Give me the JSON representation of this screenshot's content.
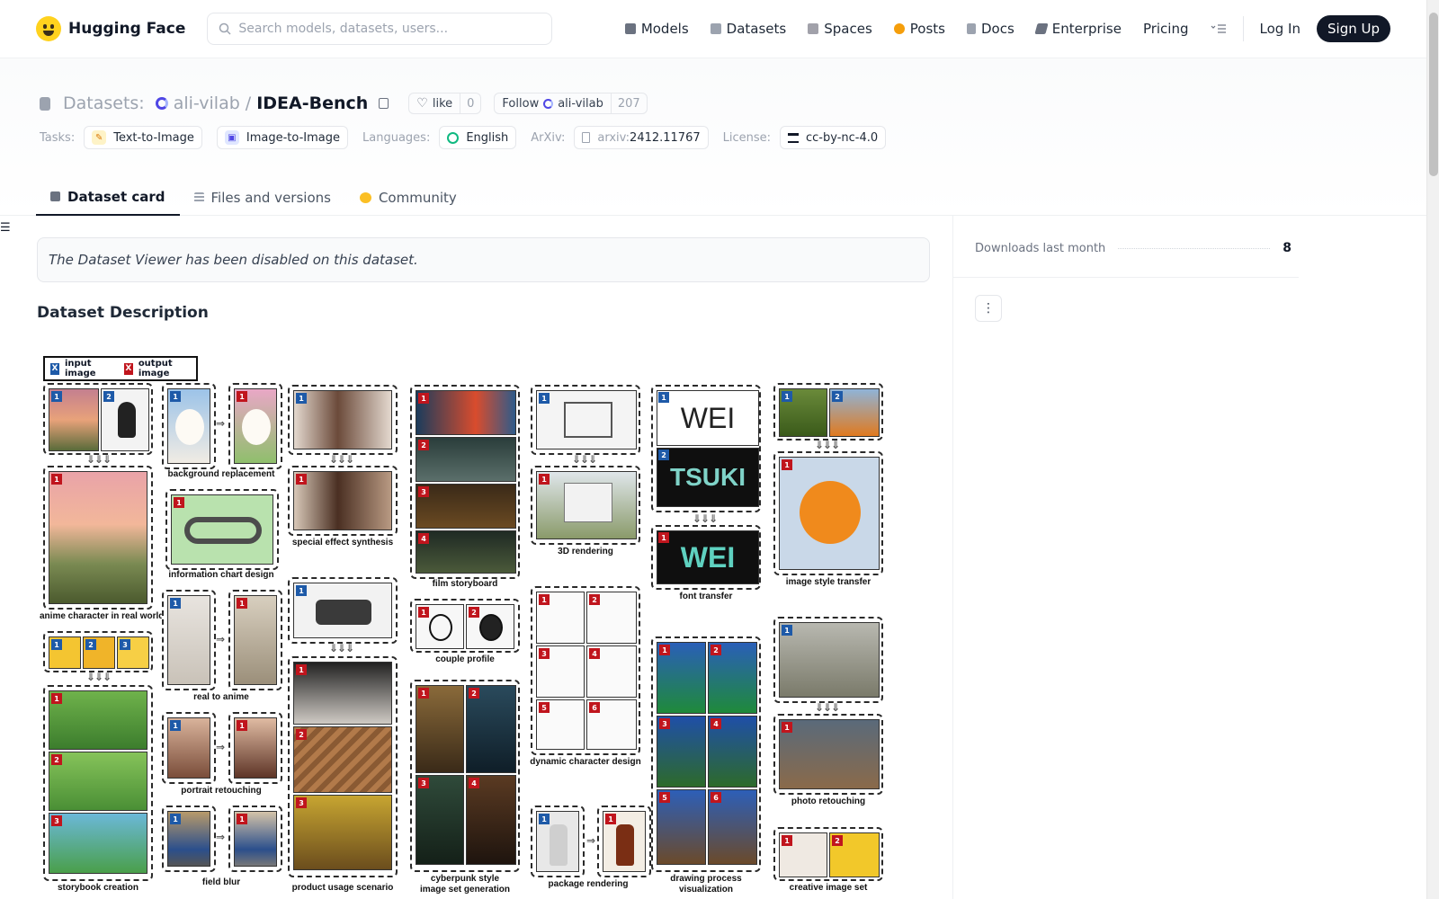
{
  "nav": {
    "brand": "Hugging Face",
    "search_placeholder": "Search models, datasets, users...",
    "links": [
      "Models",
      "Datasets",
      "Spaces",
      "Posts",
      "Docs",
      "Enterprise",
      "Pricing"
    ],
    "login": "Log In",
    "signup": "Sign Up"
  },
  "header": {
    "section": "Datasets:",
    "org": "ali-vilab",
    "separator": "/",
    "repo": "IDEA-Bench",
    "like_label": "like",
    "like_count": "0",
    "follow_label": "Follow",
    "follow_org": "ali-vilab",
    "follow_count": "207",
    "tasks_label": "Tasks:",
    "tasks": [
      "Text-to-Image",
      "Image-to-Image"
    ],
    "languages_label": "Languages:",
    "language": "English",
    "arxiv_label": "ArXiv:",
    "arxiv_prefix": "arxiv:",
    "arxiv_id": "2412.11767",
    "license_label": "License:",
    "license": "cc-by-nc-4.0"
  },
  "tabs": [
    "Dataset card",
    "Files and versions",
    "Community"
  ],
  "main": {
    "viewer_notice": "The Dataset Viewer has been disabled on this dataset.",
    "section_title": "Dataset Description"
  },
  "sidebar": {
    "downloads_label": "Downloads last month",
    "downloads_value": "8"
  },
  "figure": {
    "legend_input": "input image",
    "legend_output": "output image",
    "legend_in_mark": "X",
    "legend_out_mark": "X",
    "captions": {
      "anime": "anime character in real world",
      "storybook": "storybook creation",
      "background": "background replacement",
      "infochart": "information chart design",
      "real_anime": "real to anime",
      "portrait": "portrait retouching",
      "field_blur": "field blur",
      "special": "special effect synthesis",
      "product": "product usage scenario",
      "film": "film storyboard",
      "couple": "couple profile",
      "cyber1": "cyberpunk style",
      "cyber2": "image set generation",
      "render3d": "3D rendering",
      "dynamic": "dynamic character design",
      "package": "package rendering",
      "font": "font transfer",
      "drawing1": "drawing process",
      "drawing2": "visualization",
      "style": "image style transfer",
      "photo": "photo retouching",
      "creative": "creative image set"
    },
    "font_text_1": "WEI",
    "font_text_2": "TSUKI",
    "font_text_3": "WEI"
  },
  "colors": {
    "brand_yellow": "#ffd21e",
    "input_badge": "#1e5aa8",
    "output_badge": "#c0151d",
    "signup_bg": "#111827"
  }
}
